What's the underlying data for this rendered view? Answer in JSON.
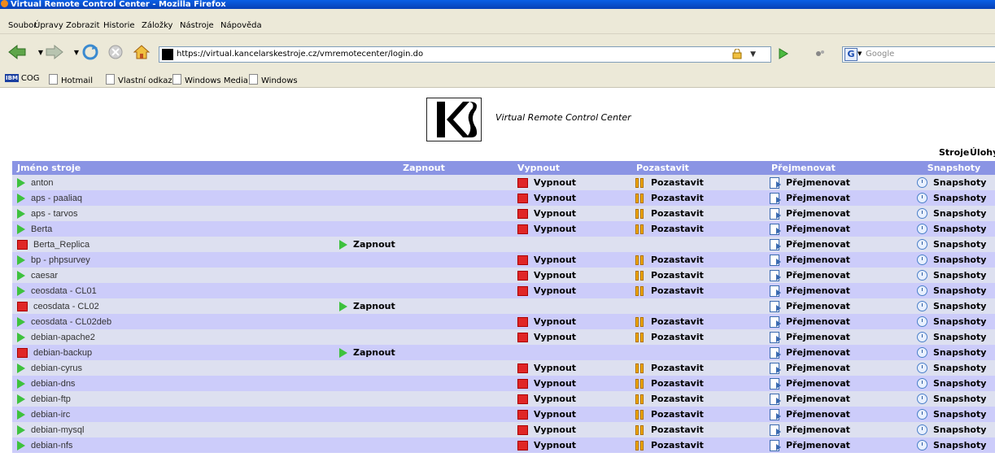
{
  "window": {
    "title": "Virtual Remote Control Center - Mozilla Firefox"
  },
  "menu": [
    "Soubor",
    "Úpravy",
    "Zobrazit",
    "Historie",
    "Záložky",
    "Nástroje",
    "Nápověda"
  ],
  "address": {
    "url": "https://virtual.kancelarskestroje.cz/vmremotecenter/login.do"
  },
  "search": {
    "placeholder": "Google"
  },
  "bookmarks": [
    "COG",
    "Hotmail",
    "Vlastní odkazy",
    "Windows Media",
    "Windows"
  ],
  "app": {
    "title": "Virtual Remote Control Center"
  },
  "topnav": {
    "machines": "Stroje",
    "tasks": "Úlohy"
  },
  "columns": {
    "name": "Jméno stroje",
    "start": "Zapnout",
    "stop": "Vypnout",
    "pause": "Pozastavit",
    "rename": "Přejmenovat",
    "snapshots": "Snapshoty"
  },
  "actions": {
    "start": "Zapnout",
    "stop": "Vypnout",
    "pause": "Pozastavit",
    "rename": "Přejmenovat",
    "snapshots": "Snapshoty"
  },
  "machines": [
    {
      "name": "anton",
      "running": true
    },
    {
      "name": "aps - paaliaq",
      "running": true
    },
    {
      "name": "aps - tarvos",
      "running": true
    },
    {
      "name": "Berta",
      "running": true
    },
    {
      "name": "Berta_Replica",
      "running": false
    },
    {
      "name": "bp - phpsurvey",
      "running": true
    },
    {
      "name": "caesar",
      "running": true
    },
    {
      "name": "ceosdata - CL01",
      "running": true
    },
    {
      "name": "ceosdata - CL02",
      "running": false
    },
    {
      "name": "ceosdata - CL02deb",
      "running": true
    },
    {
      "name": "debian-apache2",
      "running": true
    },
    {
      "name": "debian-backup",
      "running": false
    },
    {
      "name": "debian-cyrus",
      "running": true
    },
    {
      "name": "debian-dns",
      "running": true
    },
    {
      "name": "debian-ftp",
      "running": true
    },
    {
      "name": "debian-irc",
      "running": true
    },
    {
      "name": "debian-mysql",
      "running": true
    },
    {
      "name": "debian-nfs",
      "running": true
    }
  ],
  "colors": {
    "header": "#8a94e4",
    "row_odd": "#dde0f0",
    "row_even": "#ccccfa",
    "running": "#3ec23e",
    "stopped": "#e02626"
  }
}
